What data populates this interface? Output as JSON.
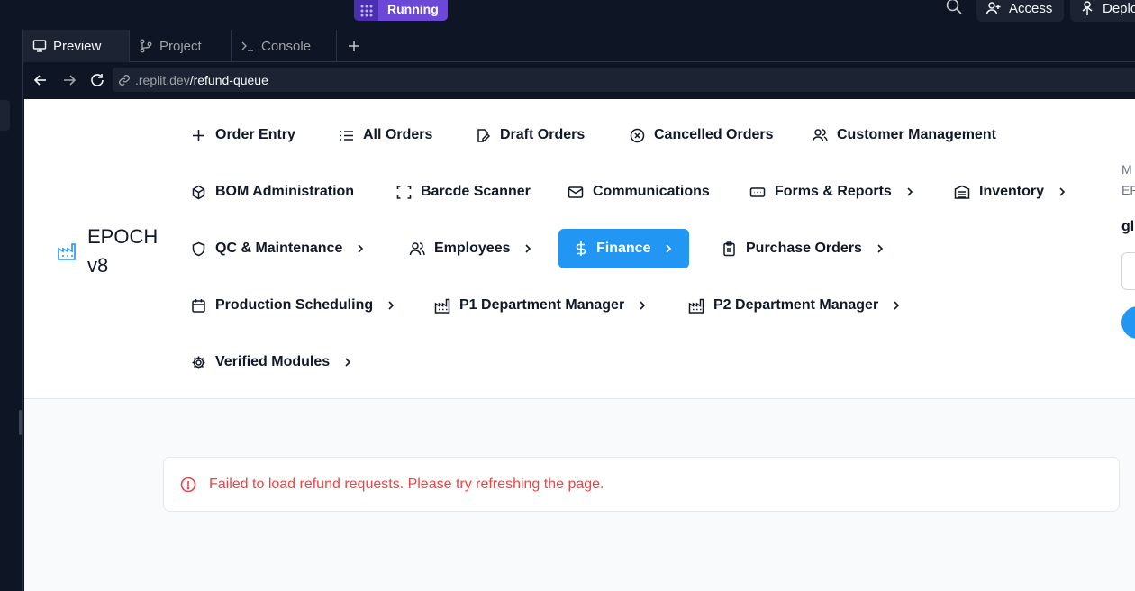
{
  "topbar": {
    "run_label": "Running",
    "access_label": "Access",
    "deploy_label": "Deplo"
  },
  "tabs": [
    {
      "label": "Preview",
      "icon": "monitor-icon"
    },
    {
      "label": "Project",
      "icon": "git-branch-icon"
    },
    {
      "label": "Console",
      "icon": "terminal-icon"
    }
  ],
  "address": {
    "domain": ".replit.dev",
    "path": "/refund-queue"
  },
  "app": {
    "brand_line1": "EPOCH",
    "brand_line2": "v8",
    "nav": [
      {
        "label": "Order Entry",
        "icon": "plus-icon"
      },
      {
        "label": "All Orders",
        "icon": "list-icon"
      },
      {
        "label": "Draft Orders",
        "icon": "file-edit-icon"
      },
      {
        "label": "Cancelled Orders",
        "icon": "x-circle-icon"
      },
      {
        "label": "Customer Management",
        "icon": "users-icon"
      },
      {
        "label": "BOM Administration",
        "icon": "package-icon"
      },
      {
        "label": "Barcde Scanner",
        "icon": "scan-icon"
      },
      {
        "label": "Communications",
        "icon": "mail-icon"
      },
      {
        "label": "Forms & Reports",
        "icon": "form-icon"
      },
      {
        "label": "Inventory",
        "icon": "warehouse-icon"
      },
      {
        "label": "QC & Maintenance",
        "icon": "shield-icon"
      },
      {
        "label": "Employees",
        "icon": "users-icon"
      },
      {
        "label": "Finance",
        "icon": "dollar-icon",
        "active": true
      },
      {
        "label": "Purchase Orders",
        "icon": "clipboard-icon"
      },
      {
        "label": "Production Scheduling",
        "icon": "calendar-icon"
      },
      {
        "label": "P1 Department Manager",
        "icon": "factory-icon"
      },
      {
        "label": "P2 Department Manager",
        "icon": "factory-icon"
      },
      {
        "label": "Verified Modules",
        "icon": "gear-icon"
      }
    ],
    "side_fragments": [
      "M",
      "ER",
      "gl"
    ],
    "error_message": "Failed to load refund requests. Please try refreshing the page."
  },
  "colors": {
    "accent": "#2196f3",
    "error": "#ef4444",
    "running": "#6c48d6"
  }
}
